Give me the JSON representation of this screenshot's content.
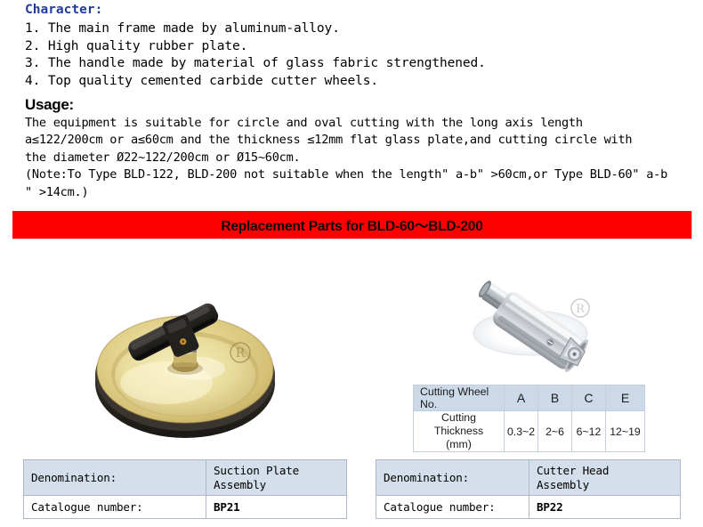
{
  "character": {
    "heading": "Character:",
    "items": [
      "1. The main frame made by aluminum-alloy.",
      "2. High quality rubber plate.",
      "3. The handle made by material of glass fabric strengthened.",
      "4. Top quality cemented carbide cutter wheels."
    ],
    "heading_color": "#1f3d99"
  },
  "usage": {
    "heading": "Usage:",
    "lines": [
      "The equipment is suitable for circle and oval cutting with the long axis length",
      "a≤122/200cm or a≤60cm and the thickness ≤12mm flat glass plate,and cutting circle with",
      "the diameter Ø22~122/200cm or Ø15~60cm.",
      "(Note:To Type BLD-122, BLD-200 not suitable when the length\" a-b\" >60cm,or Type BLD-60\" a-b",
      "\" >14cm.)"
    ]
  },
  "banner": {
    "title": "Replacement Parts for BLD-60〜BLD-200",
    "background": "#fe0000",
    "text_color": "#0a0a0a"
  },
  "products": {
    "left": {
      "image_name": "suction-plate-assembly-photo",
      "trademark": "®"
    },
    "right": {
      "image_name": "cutter-head-assembly-photo",
      "trademark": "®"
    }
  },
  "wheel_table": {
    "row_header_label": "Cutting Wheel No.",
    "row_thickness_label": "Cutting Thickness\n(mm)",
    "wheels": [
      "A",
      "B",
      "C",
      "E"
    ],
    "thickness": [
      "0.3~2",
      "2~6",
      "6~12",
      "12~19"
    ],
    "header_bg": "#ccd9e8"
  },
  "spec_left": {
    "denomination_label": "Denomination:",
    "denomination_value": "Suction Plate\nAssembly",
    "catalogue_label": "Catalogue number:",
    "catalogue_value": "BP21",
    "header_bg": "#d5dfeb",
    "catalogue_color": "#1f1fc8"
  },
  "spec_right": {
    "denomination_label": "Denomination:",
    "denomination_value": "Cutter Head\nAssembly",
    "catalogue_label": "Catalogue number:",
    "catalogue_value": "BP22",
    "header_bg": "#d5dfeb",
    "catalogue_color": "#1f1fc8"
  }
}
